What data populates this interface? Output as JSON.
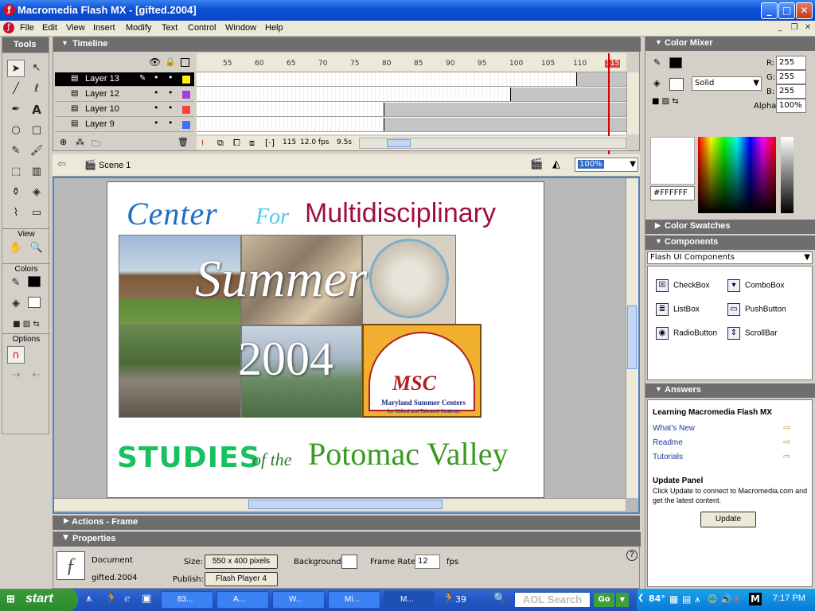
{
  "window": {
    "title": "Macromedia Flash MX - [gifted.2004]",
    "min": "_",
    "max": "□",
    "close": "✕"
  },
  "menu": [
    "File",
    "Edit",
    "View",
    "Insert",
    "Modify",
    "Text",
    "Control",
    "Window",
    "Help"
  ],
  "tools": {
    "header": "Tools",
    "view_label": "View",
    "colors_label": "Colors",
    "options_label": "Options"
  },
  "timeline": {
    "header": "Timeline",
    "ticks": [
      "55",
      "60",
      "65",
      "70",
      "75",
      "80",
      "85",
      "90",
      "95",
      "100",
      "105",
      "110",
      "115"
    ],
    "layers": [
      {
        "name": "Layer 13",
        "color": "#ffee00"
      },
      {
        "name": "Layer 12",
        "color": "#a040e0"
      },
      {
        "name": "Layer 10",
        "color": "#ff4040"
      },
      {
        "name": "Layer 9",
        "color": "#4070ff"
      }
    ],
    "frame": "115",
    "fps": "12.0 fps",
    "time": "9.5s"
  },
  "editbar": {
    "scene": "Scene 1",
    "zoom": "100%"
  },
  "stage": {
    "title_center": "Center",
    "title_for": "For",
    "title_multi": "Multidisciplinary",
    "summer": "Summer",
    "year": "2004",
    "msc_logo": "MSC",
    "msc_line1": "Maryland Summer Centers",
    "msc_line2": "for Gifted and Talented Students",
    "studies": "STUDIES",
    "ofthe": "of the",
    "potomac": "Potomac Valley"
  },
  "actions": {
    "header": "Actions - Frame"
  },
  "properties": {
    "header": "Properties",
    "doc_label": "Document",
    "doc_name": "gifted.2004",
    "size_label": "Size:",
    "size_value": "550 x 400 pixels",
    "bg_label": "Background:",
    "rate_label": "Frame Rate:",
    "rate_value": "12",
    "fps_label": "fps",
    "publish_label": "Publish:",
    "publish_value": "Flash Player 4"
  },
  "color_mixer": {
    "header": "Color Mixer",
    "r_label": "R:",
    "r": "255",
    "g_label": "G:",
    "g": "255",
    "b_label": "B:",
    "b": "255",
    "alpha_label": "Alpha:",
    "alpha": "100%",
    "fill_type": "Solid",
    "hex": "#FFFFFF"
  },
  "swatches": {
    "header": "Color Swatches"
  },
  "components": {
    "header": "Components",
    "set": "Flash UI Components",
    "items": [
      "CheckBox",
      "ComboBox",
      "ListBox",
      "PushButton",
      "RadioButton",
      "ScrollBar"
    ]
  },
  "answers": {
    "header": "Answers",
    "title": "Learning Macromedia Flash MX",
    "links": [
      "What's New",
      "Readme",
      "Tutorials"
    ],
    "update_title": "Update Panel",
    "update_text": "Click Update to connect to Macromedia.com and get the latest content.",
    "update_button": "Update"
  },
  "taskbar": {
    "start": "start",
    "tasks": [
      "83...",
      "A...",
      "W...",
      "Mi...",
      "M..."
    ],
    "count": "39",
    "search": "AOL Search",
    "go": "Go",
    "temp": "84°",
    "clock": "7:17 PM"
  }
}
